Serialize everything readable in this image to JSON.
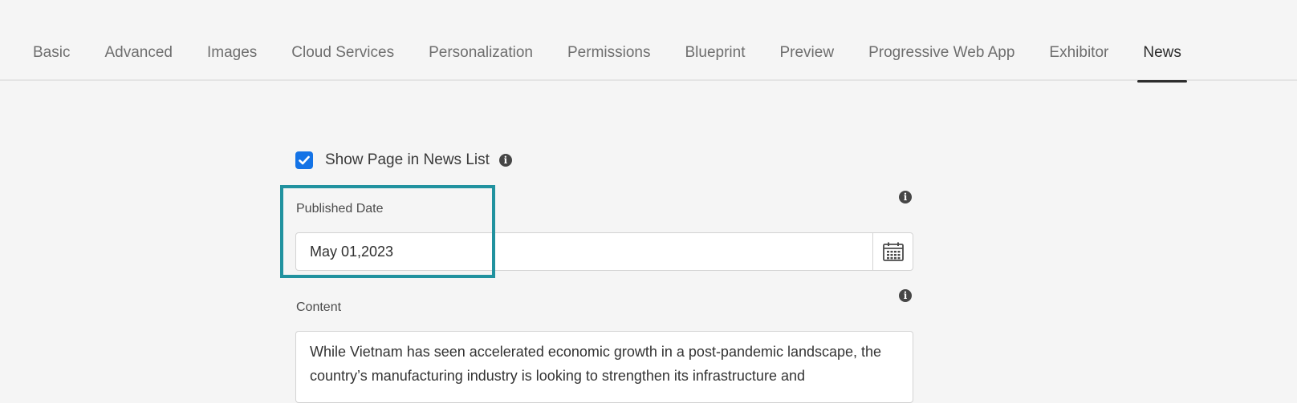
{
  "tabs": [
    {
      "label": "Basic",
      "active": false
    },
    {
      "label": "Advanced",
      "active": false
    },
    {
      "label": "Images",
      "active": false
    },
    {
      "label": "Cloud Services",
      "active": false
    },
    {
      "label": "Personalization",
      "active": false
    },
    {
      "label": "Permissions",
      "active": false
    },
    {
      "label": "Blueprint",
      "active": false
    },
    {
      "label": "Preview",
      "active": false
    },
    {
      "label": "Progressive Web App",
      "active": false
    },
    {
      "label": "Exhibitor",
      "active": false
    },
    {
      "label": "News",
      "active": true
    }
  ],
  "form": {
    "show_in_news_list": {
      "label": "Show Page in News List",
      "checked": true
    },
    "published_date": {
      "label": "Published Date",
      "value": "May 01,2023"
    },
    "content": {
      "label": "Content",
      "text": "While Vietnam has seen accelerated economic growth in a post-pandemic landscape, the country’s manufacturing industry is looking to strengthen its infrastructure and"
    }
  },
  "icons": {
    "info": "info-icon",
    "calendar": "calendar-icon",
    "checkmark": "checkmark-icon"
  },
  "colors": {
    "accent": "#1473e6",
    "highlight": "#21929f",
    "background": "#f5f5f5"
  }
}
